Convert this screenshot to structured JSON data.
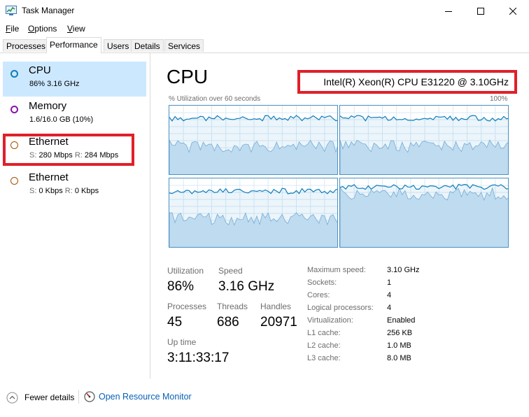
{
  "window": {
    "title": "Task Manager"
  },
  "menu": [
    {
      "label": "File",
      "u": "F",
      "rest": "ile"
    },
    {
      "label": "Options",
      "u": "O",
      "rest": "ptions"
    },
    {
      "label": "View",
      "u": "V",
      "rest": "iew"
    }
  ],
  "tabs": [
    "Processes",
    "Performance",
    "Users",
    "Details",
    "Services"
  ],
  "sidebar": {
    "items": [
      {
        "title": "CPU",
        "sub": "86%  3.16 GHz",
        "color": "#117dbb"
      },
      {
        "title": "Memory",
        "sub": "1.6/16.0 GB (10%)",
        "color": "#8b12ae"
      },
      {
        "title": "Ethernet",
        "s_label": "S:",
        "s_val": "280 Mbps",
        "r_label": "R:",
        "r_val": "284 Mbps",
        "color": "#a74f01"
      },
      {
        "title": "Ethernet",
        "s_label": "S:",
        "s_val": "0 Kbps",
        "r_label": "R:",
        "r_val": "0 Kbps",
        "color": "#a74f01"
      }
    ]
  },
  "main": {
    "title": "CPU",
    "model": "Intel(R) Xeon(R) CPU E31220 @ 3.10GHz",
    "graph_label_left": "% Utilization over 60 seconds",
    "graph_label_right": "100%"
  },
  "stats": {
    "utilization_label": "Utilization",
    "utilization": "86%",
    "speed_label": "Speed",
    "speed": "3.16 GHz",
    "processes_label": "Processes",
    "processes": "45",
    "threads_label": "Threads",
    "threads": "686",
    "handles_label": "Handles",
    "handles": "20971",
    "uptime_label": "Up time",
    "uptime": "3:11:33:17"
  },
  "info": [
    {
      "label": "Maximum speed:",
      "value": "3.10 GHz"
    },
    {
      "label": "Sockets:",
      "value": "1"
    },
    {
      "label": "Cores:",
      "value": "4"
    },
    {
      "label": "Logical processors:",
      "value": "4"
    },
    {
      "label": "Virtualization:",
      "value": "Enabled"
    },
    {
      "label": "L1 cache:",
      "value": "256 KB"
    },
    {
      "label": "L2 cache:",
      "value": "1.0 MB"
    },
    {
      "label": "L3 cache:",
      "value": "8.0 MB"
    }
  ],
  "footer": {
    "fewer_details_label": "Fewer details",
    "resource_monitor_label": "Open Resource Monitor"
  },
  "colors": {
    "accent": "#117dbb",
    "selected": "#cce8ff",
    "highlight": "#e0202a",
    "link": "#0a60b5"
  }
}
